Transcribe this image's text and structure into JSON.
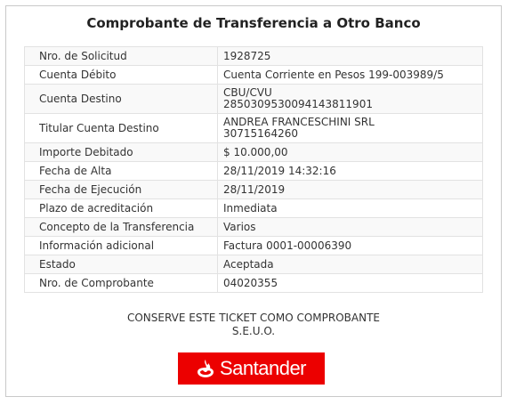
{
  "title": "Comprobante de Transferencia a Otro Banco",
  "rows": [
    {
      "label": "Nro. de Solicitud",
      "value": "1928725"
    },
    {
      "label": "Cuenta Débito",
      "value": "Cuenta Corriente en Pesos 199-003989/5"
    },
    {
      "label": "Cuenta Destino",
      "value": "CBU/CVU",
      "value2": "2850309530094143811901"
    },
    {
      "label": "Titular Cuenta Destino",
      "value": "ANDREA FRANCESCHINI SRL",
      "value2": "30715164260"
    },
    {
      "label": "Importe Debitado",
      "value": "$ 10.000,00"
    },
    {
      "label": "Fecha de Alta",
      "value": "28/11/2019 14:32:16"
    },
    {
      "label": "Fecha de Ejecución",
      "value": "28/11/2019"
    },
    {
      "label": "Plazo de acreditación",
      "value": "Inmediata"
    },
    {
      "label": "Concepto de la Transferencia",
      "value": "Varios"
    },
    {
      "label": "Información adicional",
      "value": "Factura 0001-00006390"
    },
    {
      "label": "Estado",
      "value": "Aceptada"
    },
    {
      "label": "Nro. de Comprobante",
      "value": "04020355"
    }
  ],
  "notice": {
    "line1": "CONSERVE ESTE TICKET COMO COMPROBANTE",
    "line2": "S.E.U.O."
  },
  "logo": {
    "text": "Santander",
    "color": "#ec0000",
    "icon": "santander-flame-icon"
  }
}
